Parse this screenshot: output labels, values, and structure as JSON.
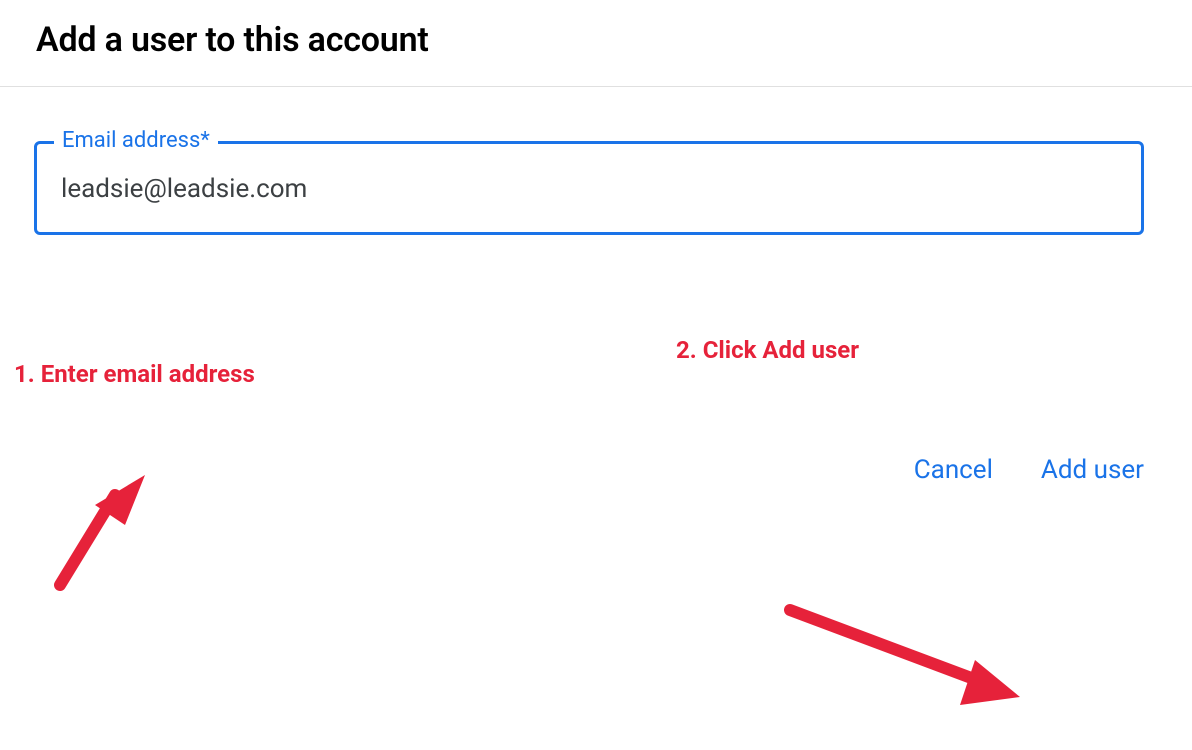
{
  "header": {
    "title": "Add a user to this account"
  },
  "form": {
    "email_label": "Email address*",
    "email_value": "leadsie@leadsie.com"
  },
  "actions": {
    "cancel_label": "Cancel",
    "add_user_label": "Add user"
  },
  "annotations": {
    "step1": "1. Enter email address",
    "step2": "2. Click Add user"
  },
  "colors": {
    "accent": "#1a73e8",
    "annotation": "#e6223a"
  }
}
